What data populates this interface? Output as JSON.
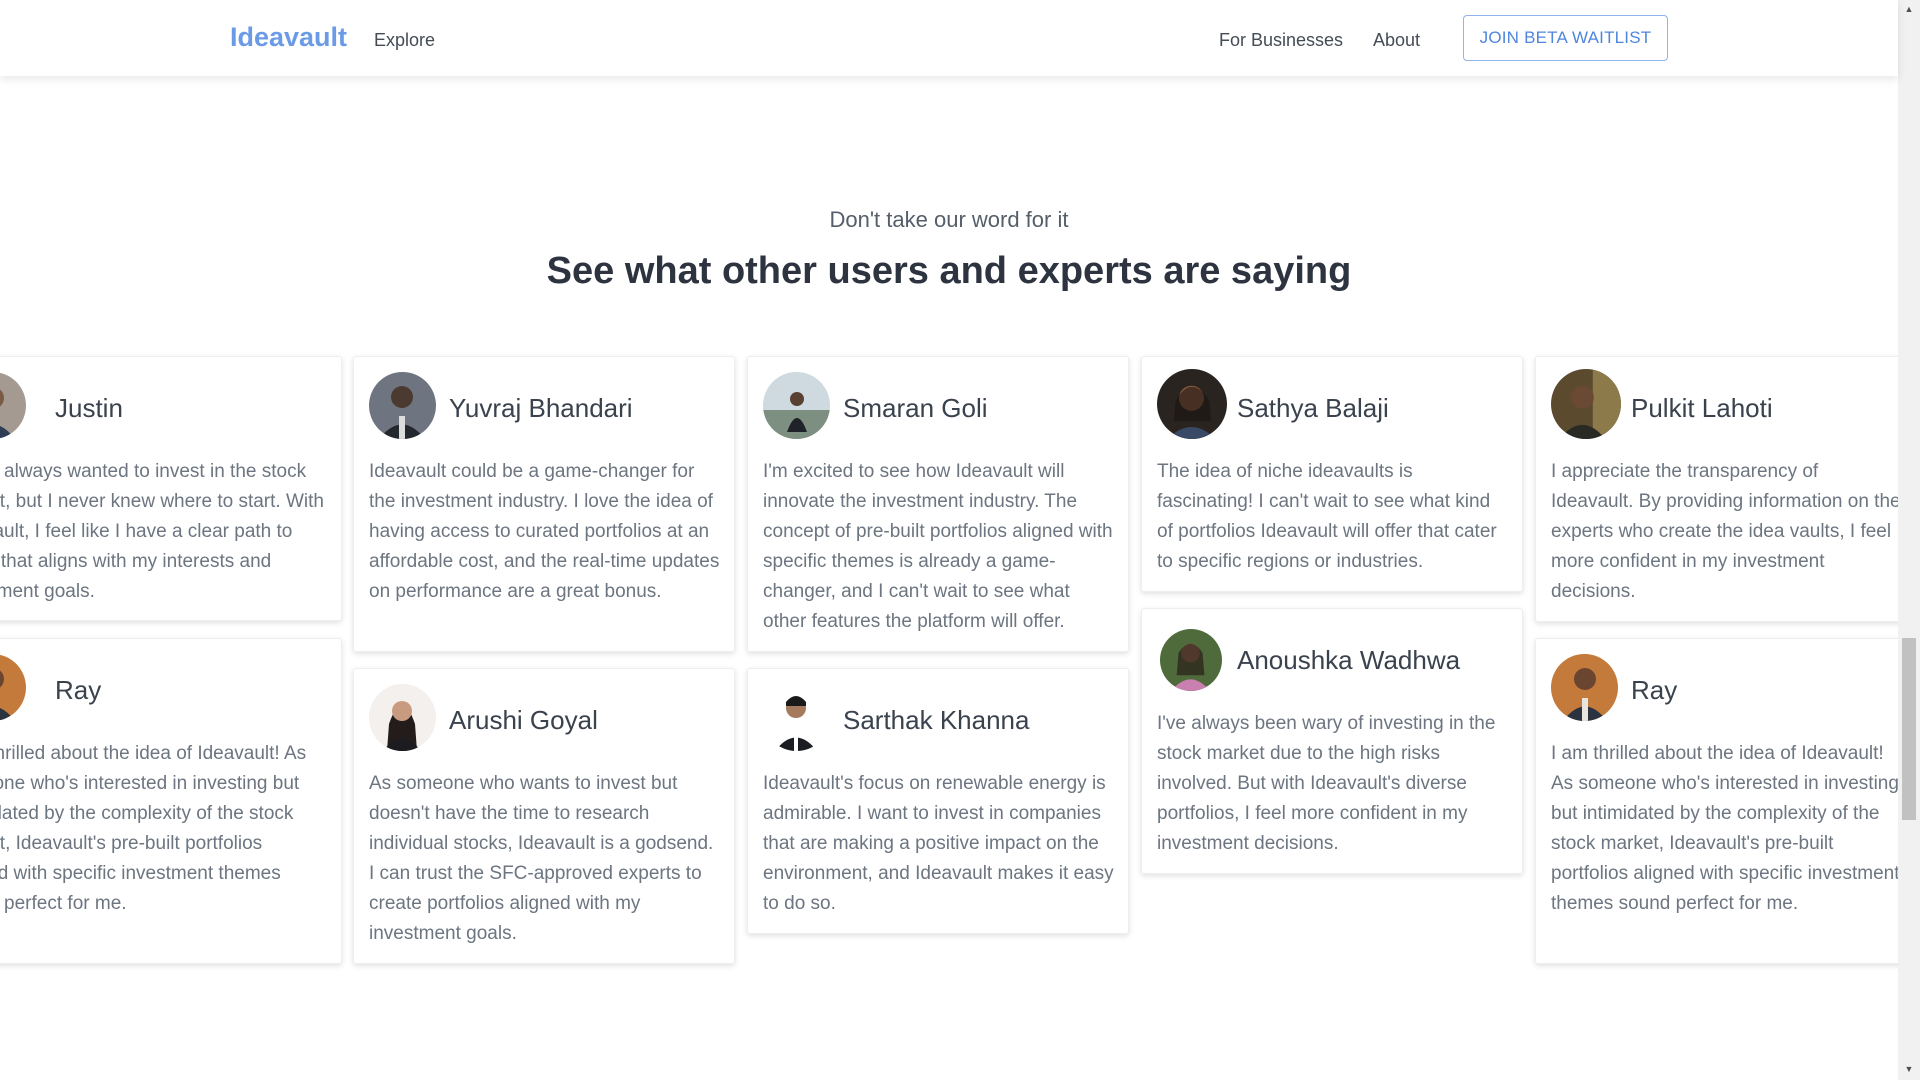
{
  "nav": {
    "brand": "Ideavault",
    "explore": "Explore",
    "for_businesses": "For Businesses",
    "about": "About",
    "join_button": "JOIN BETA WAITLIST",
    "brand_color": "#6b9ae6"
  },
  "section": {
    "eyebrow": "Don't take our word for it",
    "heading": "See what other users and experts are saying"
  },
  "testimonials": [
    {
      "name": "Justin",
      "quote": "I have always wanted to invest in the stock market, but I never knew where to start. With Ideavault, I feel like I have a clear path to follow that aligns with my interests and investment goals."
    },
    {
      "name": "Ray",
      "quote": "I am thrilled about the idea of Ideavault! As someone who's interested in investing but intimidated by the complexity of the stock market, Ideavault's pre-built portfolios aligned with specific investment themes sound perfect for me."
    },
    {
      "name": "Yuvraj Bhandari",
      "quote": "Ideavault could be a game-changer for the investment industry. I love the idea of having access to curated portfolios at an affordable cost, and the real-time updates on performance are a great bonus."
    },
    {
      "name": "Arushi Goyal",
      "quote": "As someone who wants to invest but doesn't have the time to research individual stocks, Ideavault is a godsend. I can trust the SFC-approved experts to create portfolios aligned with my investment goals."
    },
    {
      "name": "Smaran Goli",
      "quote": "I'm excited to see how Ideavault will innovate the investment industry. The concept of pre-built portfolios aligned with specific themes is already a game-changer, and I can't wait to see what other features the platform will offer."
    },
    {
      "name": "Sarthak Khanna",
      "quote": "Ideavault's focus on renewable energy is admirable. I want to invest in companies that are making a positive impact on the environment, and Ideavault makes it easy to do so."
    },
    {
      "name": "Sathya Balaji",
      "quote": "The idea of niche ideavaults is fascinating! I can't wait to see what kind of portfolios Ideavault will offer that cater to specific regions or industries."
    },
    {
      "name": "Anoushka Wadhwa",
      "quote": "I've always been wary of investing in the stock market due to the high risks involved. But with Ideavault's diverse portfolios, I feel more confident in my investment decisions."
    },
    {
      "name": "Pulkit Lahoti",
      "quote": "I appreciate the transparency of Ideavault. By providing information on the experts who create the idea vaults, I feel more confident in my investment decisions."
    },
    {
      "name": "Ray",
      "quote": "I am thrilled about the idea of Ideavault! As someone who's interested in investing but intimidated by the complexity of the stock market, Ideavault's pre-built portfolios aligned with specific investment themes sound perfect for me."
    }
  ]
}
